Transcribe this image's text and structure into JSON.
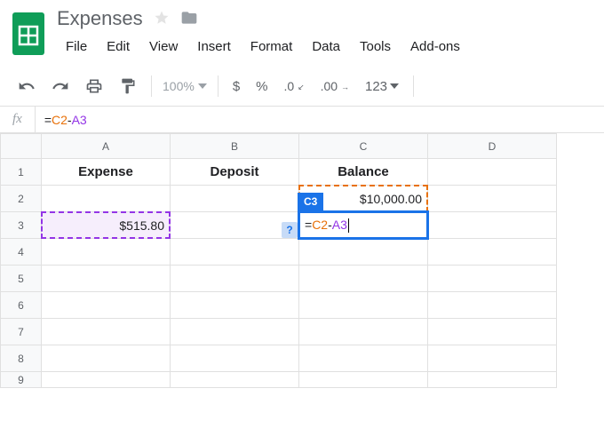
{
  "doc": {
    "title": "Expenses"
  },
  "menu": {
    "file": "File",
    "edit": "Edit",
    "view": "View",
    "insert": "Insert",
    "format": "Format",
    "data": "Data",
    "tools": "Tools",
    "addons": "Add-ons"
  },
  "toolbar": {
    "zoom": "100%",
    "dollar": "$",
    "percent": "%",
    "dec_dec": ".0",
    "dec_inc": ".00",
    "more_fmt": "123"
  },
  "formula": {
    "fx": "fx",
    "eq": "=",
    "ref1": "C2",
    "op": "-",
    "ref2": "A3"
  },
  "columns": {
    "A": "A",
    "B": "B",
    "C": "C",
    "D": "D"
  },
  "rows": {
    "1": "1",
    "2": "2",
    "3": "3",
    "4": "4",
    "5": "5",
    "6": "6",
    "7": "7",
    "8": "8",
    "9": "9"
  },
  "cells": {
    "A1": "Expense",
    "B1": "Deposit",
    "C1": "Balance",
    "C2": "$10,000.00",
    "A3": "$515.80"
  },
  "active": {
    "name_badge": "C3",
    "help": "?",
    "formula_eq": "=",
    "formula_ref1": "C2",
    "formula_op": "-",
    "formula_ref2": "A3"
  }
}
